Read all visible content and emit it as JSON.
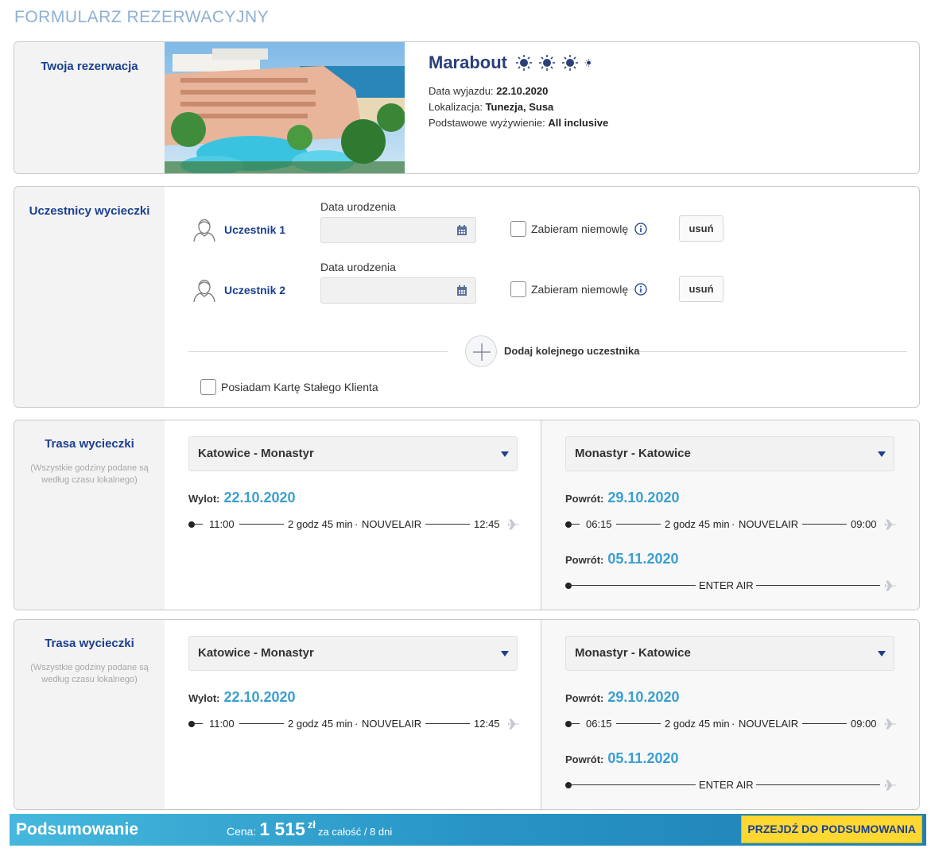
{
  "page_title": "FORMULARZ REZERWACYJNY",
  "reservation": {
    "section_title": "Twoja rezerwacja",
    "hotel_name": "Marabout",
    "stars": 3.5,
    "departure_label": "Data wyjazdu:",
    "departure_value": "22.10.2020",
    "location_label": "Lokalizacja:",
    "location_value": "Tunezja, Susa",
    "board_label": "Podstawowe wyżywienie:",
    "board_value": "All inclusive"
  },
  "participants": {
    "section_title": "Uczestnicy wycieczki",
    "items": [
      {
        "name": "Uczestnik 1",
        "dob_label": "Data urodzenia",
        "dob_value": "",
        "infant_label": "Zabieram niemowlę",
        "remove_label": "usuń"
      },
      {
        "name": "Uczestnik 2",
        "dob_label": "Data urodzenia",
        "dob_value": "",
        "infant_label": "Zabieram niemowlę",
        "remove_label": "usuń"
      }
    ],
    "add_label": "Dodaj kolejnego uczestnika",
    "loyalty_label": "Posiadam Kartę Stałego Klienta"
  },
  "routes": [
    {
      "section_title": "Trasa wycieczki",
      "note": "(Wszystkie godziny podane są według czasu lokalnego)",
      "outbound_select": "Katowice - Monastyr",
      "inbound_select": "Monastyr - Katowice",
      "outbound": {
        "label": "Wylot:",
        "date": "22.10.2020",
        "dep": "11:00",
        "duration": "2 godz 45 min",
        "sep": "·",
        "carrier": "NOUVELAIR",
        "arr": "12:45"
      },
      "returns": [
        {
          "label": "Powrót:",
          "date": "29.10.2020",
          "dep": "06:15",
          "duration": "2 godz 45 min",
          "sep": "·",
          "carrier": "NOUVELAIR",
          "arr": "09:00"
        },
        {
          "label": "Powrót:",
          "date": "05.11.2020",
          "carrier": "ENTER AIR"
        }
      ]
    },
    {
      "section_title": "Trasa wycieczki",
      "note": "(Wszystkie godziny podane są według czasu lokalnego)",
      "outbound_select": "Katowice - Monastyr",
      "inbound_select": "Monastyr - Katowice",
      "outbound": {
        "label": "Wylot:",
        "date": "22.10.2020",
        "dep": "11:00",
        "duration": "2 godz 45 min",
        "sep": "·",
        "carrier": "NOUVELAIR",
        "arr": "12:45"
      },
      "returns": [
        {
          "label": "Powrót:",
          "date": "29.10.2020",
          "dep": "06:15",
          "duration": "2 godz 45 min",
          "sep": "·",
          "carrier": "NOUVELAIR",
          "arr": "09:00"
        },
        {
          "label": "Powrót:",
          "date": "05.11.2020",
          "carrier": "ENTER AIR"
        }
      ]
    }
  ],
  "summary": {
    "title": "Podsumowanie",
    "price_label": "Cena:",
    "price_value": "1 515",
    "currency": "zł",
    "price_note": "za całość / 8 dni",
    "button_label": "PRZEJDŹ DO PODSUMOWANIA"
  },
  "colors": {
    "accent_blue": "#1b3f8f",
    "date_blue": "#3a9fd0",
    "summary_bar": "#2895c6",
    "cta_yellow": "#ffd731"
  },
  "icons": [
    "sun-icon",
    "person-icon",
    "calendar-icon",
    "info-icon",
    "plus-icon",
    "plane-icon",
    "chevron-down-icon"
  ]
}
